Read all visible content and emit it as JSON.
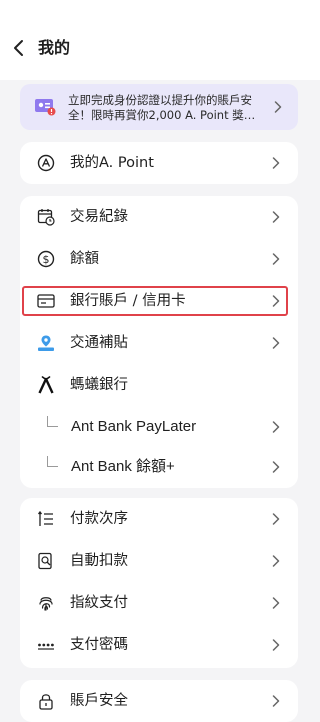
{
  "header": {
    "title": "我的"
  },
  "banner": {
    "text": "立即完成身份認證以提升你的賬戶安全！限時再賞你2,000 A. Point 獎…"
  },
  "point_card": {
    "label": "我的A. Point"
  },
  "main_menu": {
    "items": [
      {
        "label": "交易紀錄"
      },
      {
        "label": "餘額"
      },
      {
        "label": "銀行賬戶 / 信用卡"
      },
      {
        "label": "交通補貼"
      },
      {
        "label": "螞蟻銀行"
      },
      {
        "label": "Ant Bank PayLater"
      },
      {
        "label": "Ant Bank 餘額+"
      }
    ]
  },
  "payment_menu": {
    "items": [
      {
        "label": "付款次序"
      },
      {
        "label": "自動扣款"
      },
      {
        "label": "指紋支付"
      },
      {
        "label": "支付密碼"
      }
    ]
  },
  "security_menu": {
    "items": [
      {
        "label": "賬戶安全"
      }
    ]
  },
  "colors": {
    "highlight": "#e0424a",
    "banner_bg": "#e9e7fa",
    "accent_icon": "#6b4fd8"
  }
}
